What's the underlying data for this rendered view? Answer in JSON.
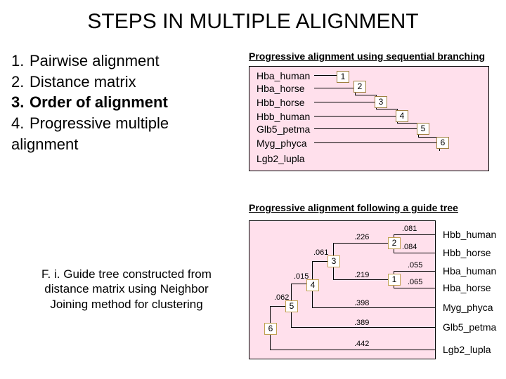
{
  "title": "STEPS IN MULTIPLE ALIGNMENT",
  "steps": {
    "s1num": "1.",
    "s1": "Pairwise alignment",
    "s2num": "2.",
    "s2": "Distance matrix",
    "s3num": "3.",
    "s3": "Order of alignment",
    "s4num": "4.",
    "s4": "Progressive multiple",
    "s5": "alignment"
  },
  "note": "F. i. Guide tree constructed from distance matrix using Neighbor Joining method for clustering",
  "panel1": {
    "title": "Progressive alignment using sequential branching",
    "seq1": "Hba_human",
    "seq2": "Hba_horse",
    "seq3": "Hbb_horse",
    "seq4": "Hbb_human",
    "seq5": "Glb5_petma",
    "seq6": "Myg_phyca",
    "seq7": "Lgb2_lupla",
    "n1": "1",
    "n2": "2",
    "n3": "3",
    "n4": "4",
    "n5": "5",
    "n6": "6"
  },
  "panel2": {
    "title": "Progressive alignment following a guide tree",
    "r1": "Hbb_human",
    "r2": "Hbb_horse",
    "r3": "Hba_human",
    "r4": "Hba_horse",
    "r5": "Myg_phyca",
    "r6": "Glb5_petma",
    "r7": "Lgb2_lupla",
    "n1": "1",
    "n2": "2",
    "n3": "3",
    "n4": "4",
    "n5": "5",
    "n6": "6",
    "d081": ".081",
    "d084": ".084",
    "d226": ".226",
    "d061": ".061",
    "d055": ".055",
    "d065": ".065",
    "d015": ".015",
    "d219": ".219",
    "d062": ".062",
    "d398": ".398",
    "d389": ".389",
    "d442": ".442"
  }
}
